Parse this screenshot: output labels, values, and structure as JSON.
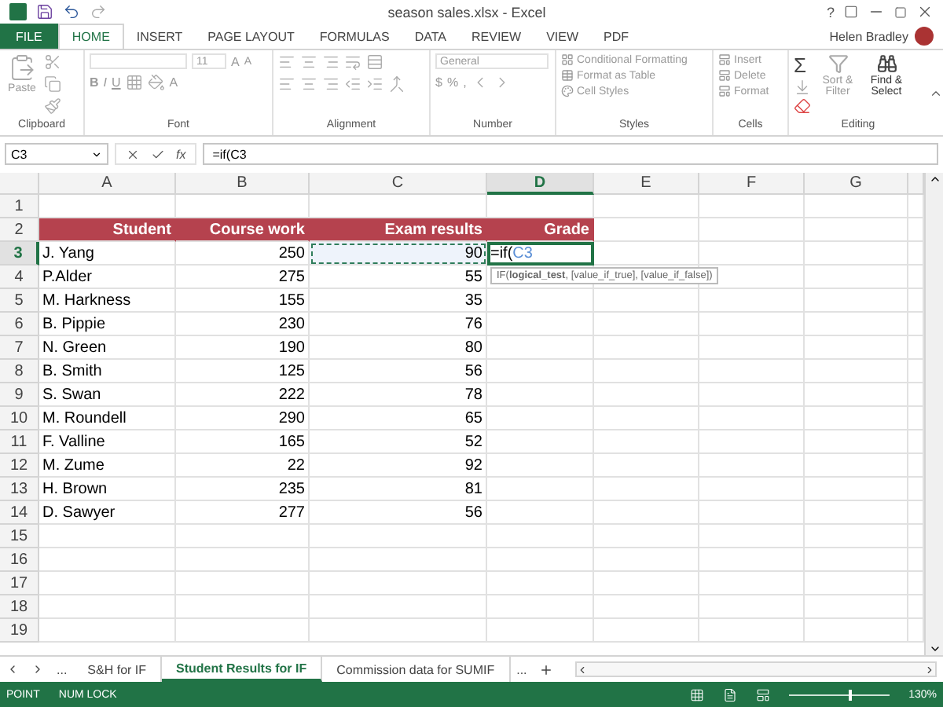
{
  "window": {
    "title": "season sales.xlsx - Excel",
    "help": "?"
  },
  "ribbon_tabs": [
    {
      "label": "FILE",
      "kind": "file",
      "selected": false
    },
    {
      "label": "HOME",
      "kind": "tab",
      "selected": true
    },
    {
      "label": "INSERT",
      "kind": "tab",
      "selected": false
    },
    {
      "label": "PAGE LAYOUT",
      "kind": "tab",
      "selected": false
    },
    {
      "label": "FORMULAS",
      "kind": "tab",
      "selected": false
    },
    {
      "label": "DATA",
      "kind": "tab",
      "selected": false
    },
    {
      "label": "REVIEW",
      "kind": "tab",
      "selected": false
    },
    {
      "label": "VIEW",
      "kind": "tab",
      "selected": false
    },
    {
      "label": "PDF",
      "kind": "tab",
      "selected": false
    }
  ],
  "user": {
    "name": "Helen Bradley"
  },
  "ribbon": {
    "disabled": true,
    "clipboard": {
      "paste": "Paste",
      "label": "Clipboard"
    },
    "font": {
      "size": "11",
      "grow": "A",
      "shrink": "A",
      "bold": "B",
      "italic": "I",
      "underline": "U",
      "font_color": "A",
      "label": "Font"
    },
    "alignment": {
      "label": "Alignment"
    },
    "number": {
      "format": "General",
      "currency": "$",
      "percent": "%",
      "comma": ",",
      "label": "Number"
    },
    "styles": {
      "items": [
        "Conditional Formatting",
        "Format as Table",
        "Cell Styles"
      ],
      "label": "Styles"
    },
    "cells": {
      "items": [
        "Insert",
        "Delete",
        "Format"
      ],
      "label": "Cells"
    },
    "editing": {
      "sum": "Σ",
      "sort": "Sort & Filter",
      "find": "Find & Select",
      "label": "Editing"
    }
  },
  "formula_bar": {
    "name_box": "C3",
    "fx": "fx",
    "formula": "=if(C3"
  },
  "columns": [
    {
      "label": "A",
      "selected": false
    },
    {
      "label": "B",
      "selected": false
    },
    {
      "label": "C",
      "selected": false
    },
    {
      "label": "D",
      "selected": true
    },
    {
      "label": "E",
      "selected": false
    },
    {
      "label": "F",
      "selected": false
    },
    {
      "label": "G",
      "selected": false
    }
  ],
  "rows": [
    {
      "number": "1",
      "kind": "plain",
      "selected": false,
      "cells": []
    },
    {
      "number": "2",
      "kind": "header",
      "selected": false,
      "cells": [
        "Student",
        "Course work",
        "Exam results",
        "Grade"
      ]
    },
    {
      "number": "3",
      "kind": "plain",
      "selected": true,
      "cells": [
        "J. Yang",
        "250",
        {
          "value": "90",
          "referenced": true
        },
        {
          "value": "=if(",
          "reference": "C3",
          "editing": true
        }
      ]
    },
    {
      "number": "4",
      "kind": "plain",
      "selected": false,
      "cells": [
        "P.Alder",
        "275",
        "55"
      ]
    },
    {
      "number": "5",
      "kind": "plain",
      "selected": false,
      "cells": [
        "M. Harkness",
        "155",
        "35"
      ]
    },
    {
      "number": "6",
      "kind": "plain",
      "selected": false,
      "cells": [
        "B. Pippie",
        "230",
        "76"
      ]
    },
    {
      "number": "7",
      "kind": "plain",
      "selected": false,
      "cells": [
        "N. Green",
        "190",
        "80"
      ]
    },
    {
      "number": "8",
      "kind": "plain",
      "selected": false,
      "cells": [
        "B. Smith",
        "125",
        "56"
      ]
    },
    {
      "number": "9",
      "kind": "plain",
      "selected": false,
      "cells": [
        "S. Swan",
        "222",
        "78"
      ]
    },
    {
      "number": "10",
      "kind": "plain",
      "selected": false,
      "cells": [
        "M. Roundell",
        "290",
        "65"
      ]
    },
    {
      "number": "11",
      "kind": "plain",
      "selected": false,
      "cells": [
        "F. Valline",
        "165",
        "52"
      ]
    },
    {
      "number": "12",
      "kind": "plain",
      "selected": false,
      "cells": [
        "M. Zume",
        "22",
        "92"
      ]
    },
    {
      "number": "13",
      "kind": "plain",
      "selected": false,
      "cells": [
        "H. Brown",
        "235",
        "81"
      ]
    },
    {
      "number": "14",
      "kind": "plain",
      "selected": false,
      "cells": [
        "D. Sawyer",
        "277",
        "56"
      ]
    },
    {
      "number": "15",
      "kind": "plain",
      "selected": false,
      "cells": []
    },
    {
      "number": "16",
      "kind": "plain",
      "selected": false,
      "cells": []
    },
    {
      "number": "17",
      "kind": "plain",
      "selected": false,
      "cells": []
    },
    {
      "number": "18",
      "kind": "plain",
      "selected": false,
      "cells": []
    },
    {
      "number": "19",
      "kind": "plain",
      "selected": false,
      "cells": []
    }
  ],
  "tooltip": "IF(**logical_test**, [value_if_true], [value_if_false])",
  "sheet_nav": {
    "more_left": "...",
    "more_right": "..."
  },
  "sheet_tabs": [
    {
      "label": "S&H for IF",
      "selected": false
    },
    {
      "label": "Student Results for IF",
      "selected": true
    },
    {
      "label": "Commission data for SUMIF",
      "selected": false
    }
  ],
  "status_bar": {
    "mode": "POINT",
    "num_lock": "NUM LOCK",
    "zoom": "130%",
    "level": 0.6
  }
}
